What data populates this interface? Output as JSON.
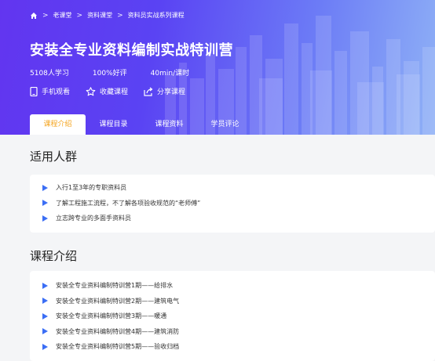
{
  "breadcrumb": {
    "items": [
      "老课堂",
      "资料课堂",
      "资料员实战系列课程"
    ],
    "separator": ">"
  },
  "course": {
    "title": "安装全专业资料编制实战特训营",
    "students": "5108人学习",
    "rating": "100%好评",
    "duration": "40min/课时"
  },
  "actions": {
    "mobile": "手机观看",
    "favorite": "收藏课程",
    "share": "分享课程"
  },
  "tabs": [
    "课程介绍",
    "课程目录",
    "课程资料",
    "学员评论"
  ],
  "audience": {
    "title": "适用人群",
    "items": [
      "入行1至3年的专职资料员",
      "了解工程施工流程，不了解各项验收规范的“老师傅”",
      "立志跨专业的多面手资料员"
    ]
  },
  "intro": {
    "title": "课程介绍",
    "items": [
      "安装全专业资料编制特训营1期——给排水",
      "安装全专业资料编制特训营2期——建筑电气",
      "安装全专业资料编制特训营3期——暖通",
      "安装全专业资料编制特训营4期——建筑消防",
      "安装全专业资料编制特训营5期——验收归档"
    ]
  },
  "colors": {
    "hero_start": "#6235f0",
    "hero_end": "#8fb1f6",
    "accent_tab": "#f5a623",
    "bullet": "#3b6ef5"
  }
}
